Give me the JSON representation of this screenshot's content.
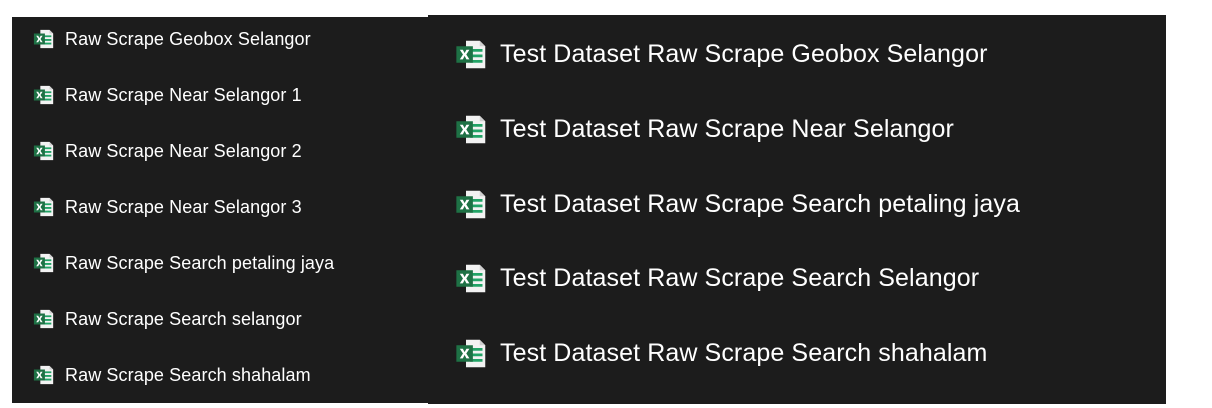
{
  "colors": {
    "panel_background": "#1c1c1c",
    "text": "#ffffff",
    "excel_green": "#1e7145",
    "excel_light": "#21a366"
  },
  "icon": "excel-file-icon",
  "left_panel": {
    "files": [
      {
        "name": "Raw Scrape Geobox Selangor"
      },
      {
        "name": "Raw Scrape Near Selangor 1"
      },
      {
        "name": "Raw Scrape Near Selangor 2"
      },
      {
        "name": "Raw Scrape Near Selangor 3"
      },
      {
        "name": "Raw Scrape Search petaling jaya"
      },
      {
        "name": "Raw Scrape Search selangor"
      },
      {
        "name": "Raw Scrape Search shahalam"
      }
    ]
  },
  "right_panel": {
    "files": [
      {
        "name": "Test Dataset Raw Scrape Geobox Selangor"
      },
      {
        "name": "Test Dataset Raw Scrape Near Selangor"
      },
      {
        "name": "Test Dataset Raw Scrape Search petaling jaya"
      },
      {
        "name": "Test Dataset Raw Scrape Search Selangor"
      },
      {
        "name": "Test Dataset Raw Scrape Search shahalam"
      }
    ]
  }
}
